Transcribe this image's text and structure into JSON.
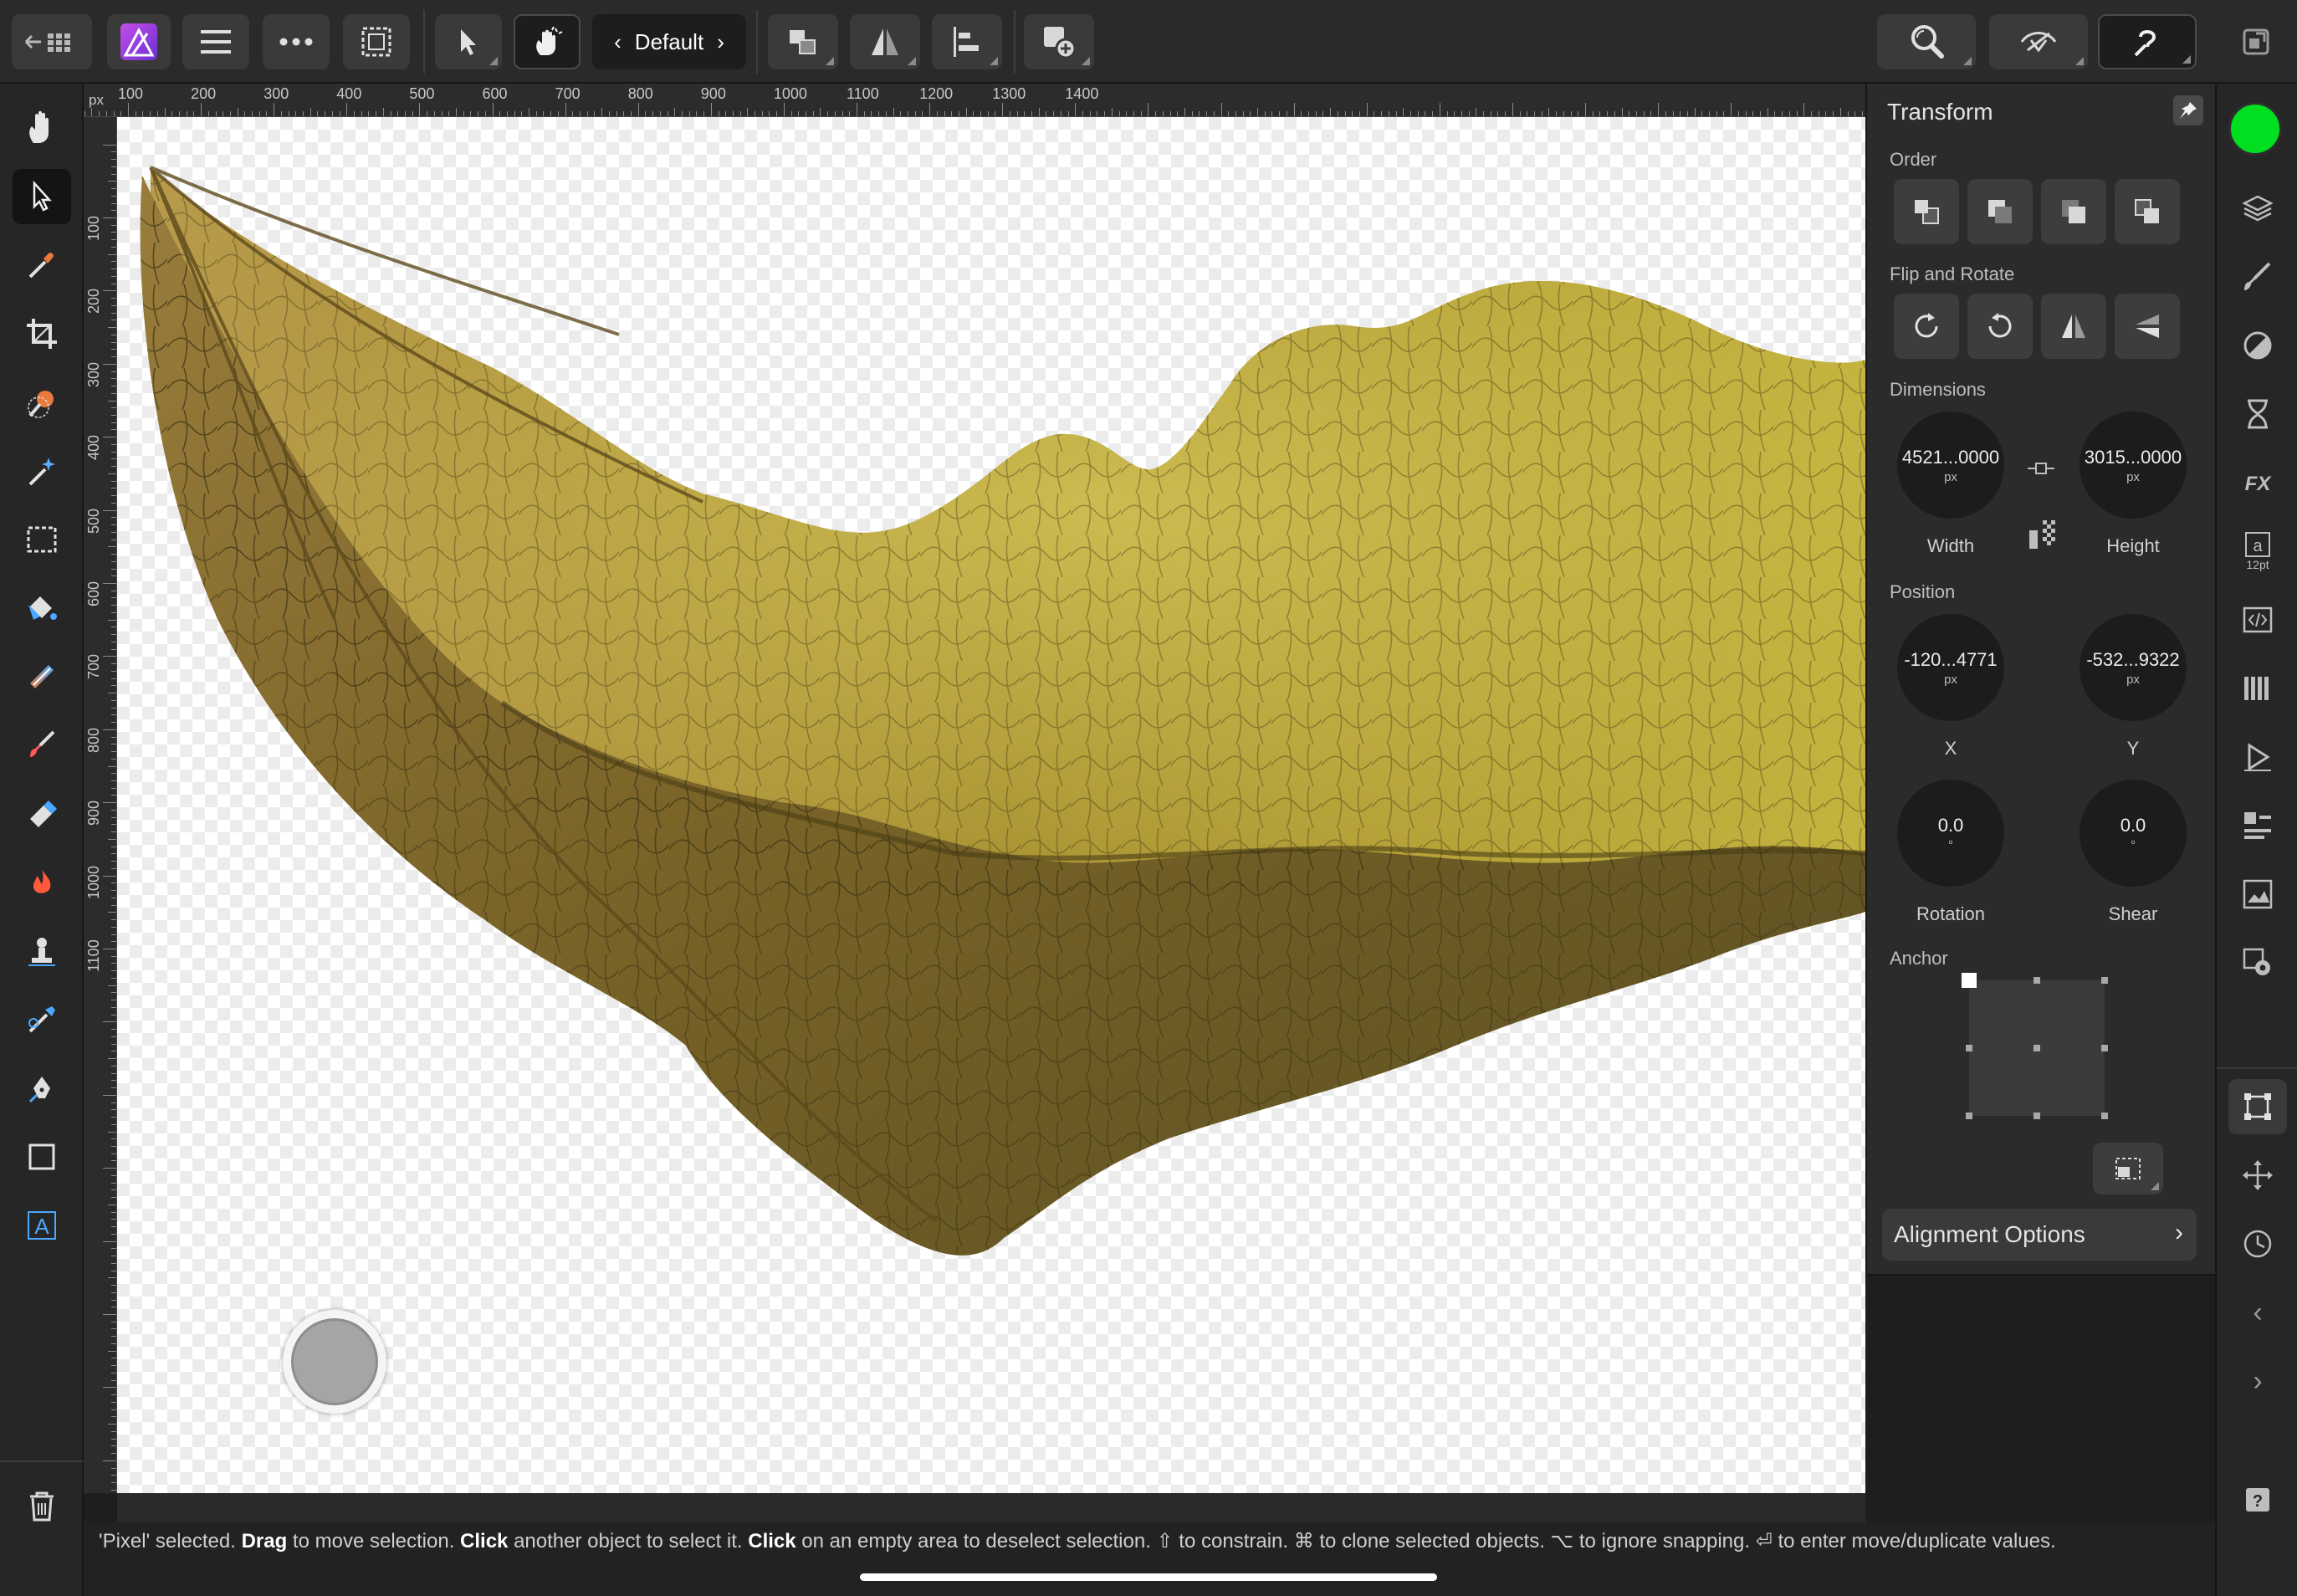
{
  "app": {
    "name": "Affinity Photo",
    "persona_label": "Default"
  },
  "colors": {
    "accent_swatch": "#00e020",
    "canvas_bg": "#ffffff",
    "panel_bg": "#2b2b2b",
    "affinity_logo": "#9b3fe0"
  },
  "toolbar": {
    "left_items": [
      "back-to-documents",
      "affinity-menu",
      "hamburger-menu",
      "more-menu",
      "selection-menu",
      "move-tool",
      "context-toolbar-toggle",
      "persona-prev",
      "persona-next",
      "arrange",
      "flip",
      "align",
      "add-layer"
    ],
    "right_items": [
      "zoom-button",
      "view-mode-button",
      "help-button",
      "compact-mode-button"
    ]
  },
  "rulers": {
    "unit": "px",
    "top_labels": [
      "100",
      "200",
      "300",
      "400",
      "500",
      "600",
      "700",
      "800",
      "900",
      "1000",
      "1100",
      "1200",
      "1300",
      "1400"
    ],
    "left_labels": [
      "100",
      "200",
      "300",
      "400",
      "500",
      "600",
      "700",
      "800",
      "900",
      "1000",
      "1100"
    ]
  },
  "left_tools": [
    "view-tool",
    "move-tool",
    "color-picker-tool",
    "crop-tool",
    "selection-brush-tool",
    "flood-select-tool",
    "marquee-tool",
    "flood-fill-tool",
    "gradient-tool",
    "paint-brush-tool",
    "erase-brush-tool",
    "burn-tool",
    "clone-tool",
    "blemish-tool",
    "pen-tool",
    "rectangle-tool",
    "text-tool"
  ],
  "transform_panel": {
    "title": "Transform",
    "sections": {
      "order": "Order",
      "flip_rotate": "Flip and Rotate",
      "dimensions": "Dimensions",
      "position": "Position",
      "anchor": "Anchor"
    },
    "width": {
      "value": "4521...0000",
      "unit": "px",
      "label": "Width"
    },
    "height": {
      "value": "3015...0000",
      "unit": "px",
      "label": "Height"
    },
    "x": {
      "value": "-120...4771",
      "unit": "px",
      "label": "X"
    },
    "y": {
      "value": "-532...9322",
      "unit": "px",
      "label": "Y"
    },
    "rotation": {
      "value": "0.0",
      "unit": "°",
      "label": "Rotation"
    },
    "shear": {
      "value": "0.0",
      "unit": "°",
      "label": "Shear"
    },
    "anchor_selected": "top-left",
    "alignment_options": "Alignment Options"
  },
  "right_strip": {
    "text_size_label": "12pt",
    "icons": [
      "layers-icon",
      "brushes-icon",
      "adjustments-icon",
      "channels-icon",
      "fx-icon",
      "text-style-icon",
      "html-icon",
      "swatches-icon",
      "play-icon",
      "stock-icon",
      "navigator-icon",
      "settings-icon",
      "transform-icon",
      "move-icon",
      "history-icon",
      "prev-icon",
      "next-icon",
      "help-icon"
    ]
  },
  "status": {
    "parts": [
      {
        "t": "'Pixel' selected. ",
        "b": false
      },
      {
        "t": "Drag",
        "b": true
      },
      {
        "t": " to move selection. ",
        "b": false
      },
      {
        "t": "Click",
        "b": true
      },
      {
        "t": " another object to select it. ",
        "b": false
      },
      {
        "t": "Click",
        "b": true
      },
      {
        "t": " on an empty area to deselect selection. ⇧ to constrain. ⌘ to clone selected objects. ⌥ to ignore snapping. ⏎ to enter move/duplicate values.",
        "b": false
      }
    ]
  }
}
